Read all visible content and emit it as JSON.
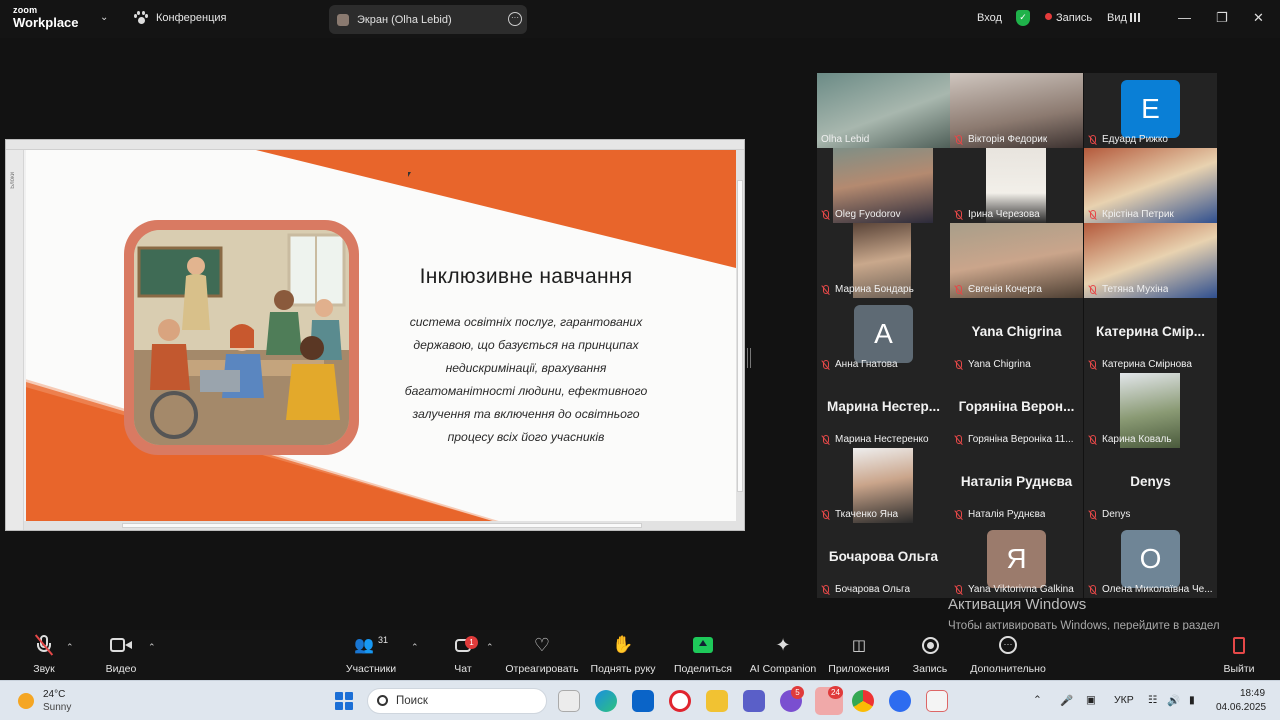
{
  "app": {
    "logo_line1": "zoom",
    "logo_line2": "Workplace",
    "conference_label": "Конференция",
    "screen_share_label": "Экран (Olha Lebid)",
    "more_glyph": "···",
    "signin_label": "Вход",
    "record_label": "Запись",
    "view_label": "Вид",
    "accent_green": "#2ecc71",
    "mute_red": "#e54848"
  },
  "slide": {
    "title": "Інклюзивне навчання",
    "body": "система освітніх послуг, гарантованих державою, що базується на принципах недискримінації, врахування багатоманітності людини, ефективного залучення та включення до освітнього процесу всіх його учасників",
    "side_tab": "Блоки",
    "orange": "#e8652b"
  },
  "participants": [
    {
      "name": "Olha Lebid",
      "type": "video",
      "muted": false,
      "active": true
    },
    {
      "name": "Вікторія Федорик",
      "type": "video",
      "muted": true
    },
    {
      "name": "Едуард Рижко",
      "type": "letter",
      "letter": "E",
      "color": "#0a7fd6",
      "muted": true
    },
    {
      "name": "Oleg Fyodorov",
      "type": "video",
      "muted": true
    },
    {
      "name": "Ірина Черезова",
      "type": "video",
      "muted": true
    },
    {
      "name": "Крістіна Петрик",
      "type": "video",
      "muted": true
    },
    {
      "name": "Марина Бондарь",
      "type": "video",
      "muted": true
    },
    {
      "name": "Євгенія Кочерга",
      "type": "video",
      "muted": true
    },
    {
      "name": "Тетяна Мухіна",
      "type": "video",
      "muted": true
    },
    {
      "name": "Анна Гнатова",
      "type": "letter",
      "letter": "A",
      "color": "#5e6a74",
      "muted": true
    },
    {
      "name": "Yana Chigrina",
      "big": "Yana Chigrina",
      "type": "name",
      "muted": true
    },
    {
      "name": "Катерина Смірнова",
      "big": "Катерина Смір...",
      "type": "name",
      "muted": true
    },
    {
      "name": "Марина Нестеренко",
      "big": "Марина Нестер...",
      "type": "name",
      "muted": true
    },
    {
      "name": "Горяніна Вероніка 11...",
      "big": "Горяніна Верон...",
      "type": "name",
      "muted": true
    },
    {
      "name": "Карина Коваль",
      "type": "video",
      "muted": true
    },
    {
      "name": "Ткаченко Яна",
      "type": "video",
      "muted": true
    },
    {
      "name": "Наталія Руднєва",
      "big": "Наталія Руднєва",
      "type": "name",
      "muted": true
    },
    {
      "name": "Denys",
      "big": "Denys",
      "type": "name",
      "muted": true
    },
    {
      "name": "Бочарова Ольга",
      "big": "Бочарова Ольга",
      "type": "name",
      "muted": true
    },
    {
      "name": "Yana Viktorivna Galkina",
      "type": "letter",
      "letter": "Я",
      "color": "#9b7b6c",
      "muted": true
    },
    {
      "name": "Олена Миколаївна Че...",
      "type": "letter",
      "letter": "O",
      "color": "#6f8596",
      "muted": true
    }
  ],
  "watermark": {
    "title": "Активация Windows",
    "text": "Чтобы активировать Windows, перейдите в раздел \"Параметры\"."
  },
  "toolbar": {
    "audio": "Звук",
    "video": "Видео",
    "participants": "Участники",
    "participants_count": "31",
    "chat": "Чат",
    "chat_badge": "1",
    "react": "Отреагировать",
    "raise_hand": "Поднять руку",
    "share": "Поделиться",
    "ai": "AI Companion",
    "apps": "Приложения",
    "record": "Запись",
    "more": "Дополнительно",
    "leave": "Выйти"
  },
  "taskbar": {
    "temp": "24°C",
    "weather": "Sunny",
    "search_placeholder": "Поиск",
    "lang": "УКР",
    "time": "18:49",
    "date": "04.06.2025",
    "badge_viber": "5",
    "badge_telegram": "24"
  }
}
